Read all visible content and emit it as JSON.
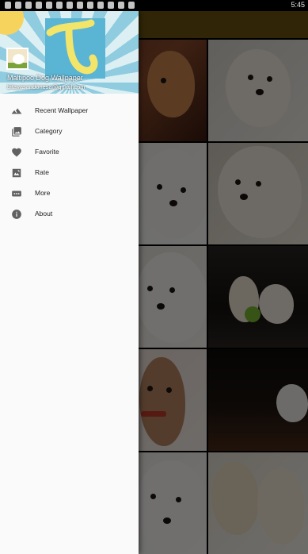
{
  "status_bar": {
    "time": "5:45"
  },
  "drawer": {
    "header": {
      "app_title": "Maltipoo Dog Wallpaper",
      "email": "bitayasandonesa@gmail.com"
    },
    "menu": [
      {
        "label": "Recent Wallpaper",
        "icon": "landscape-icon"
      },
      {
        "label": "Category",
        "icon": "collections-icon"
      },
      {
        "label": "Favorite",
        "icon": "heart-icon"
      },
      {
        "label": "Rate",
        "icon": "rate-icon"
      },
      {
        "label": "More",
        "icon": "more-icon"
      },
      {
        "label": "About",
        "icon": "info-icon"
      }
    ]
  },
  "colors": {
    "app_bar": "#6b5410",
    "drawer_bg": "#fafafa",
    "icon": "#616161"
  }
}
